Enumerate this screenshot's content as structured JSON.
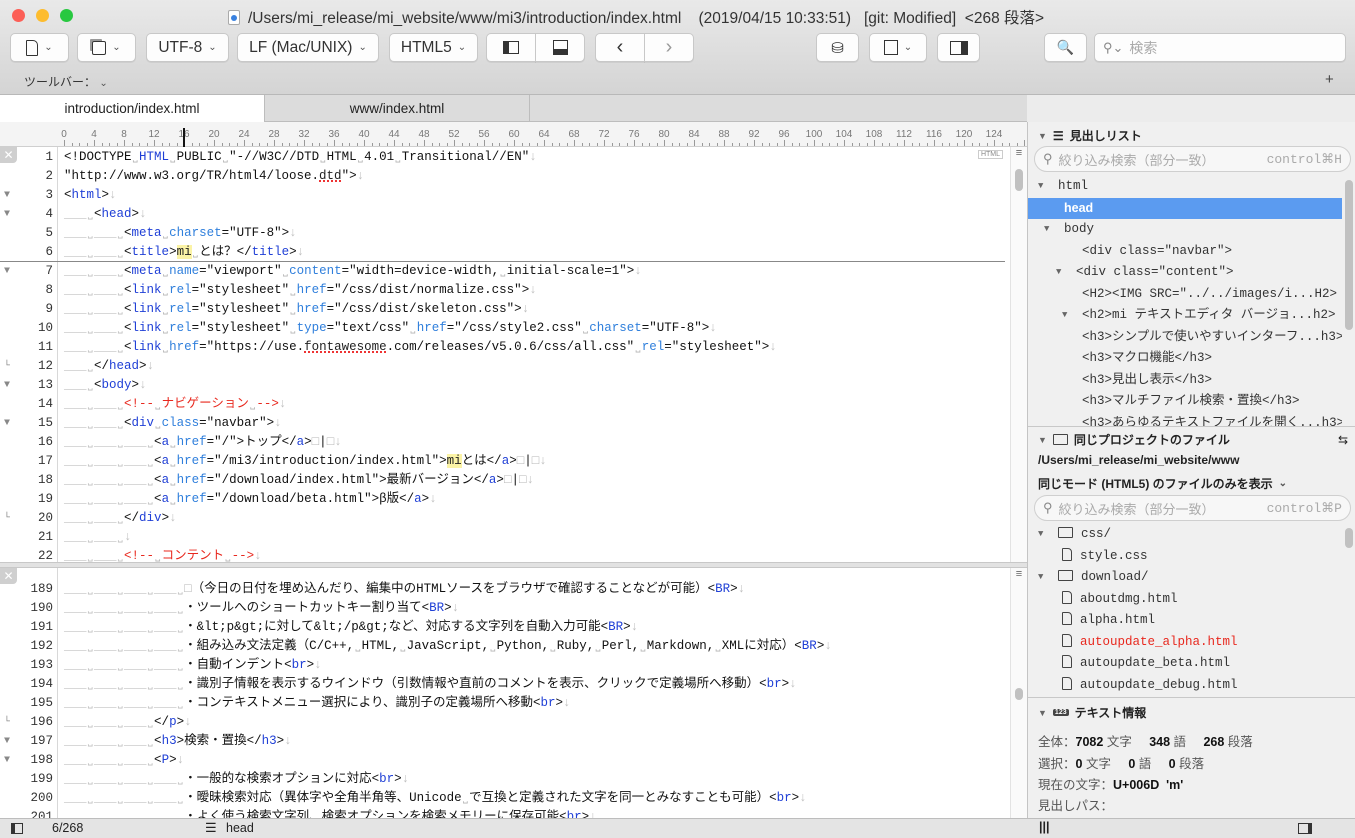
{
  "window": {
    "title": "/Users/mi_release/mi_website/www/mi3/introduction/index.html    (2019/04/15 10:33:51)   [git: Modified]  <268 段落>"
  },
  "toolbar": {
    "encoding": "UTF-8",
    "line_ending": "LF (Mac/UNIX)",
    "mode": "HTML5",
    "search_placeholder": "検索",
    "toolbar_label": "ツールバー：",
    "add_label": "+"
  },
  "tabs": [
    {
      "label": "introduction/index.html",
      "active": true
    },
    {
      "label": "www/index.html",
      "active": false
    }
  ],
  "ruler": {
    "labels": [
      "0",
      "4",
      "8",
      "12",
      "16",
      "20",
      "24",
      "28",
      "32",
      "36",
      "40",
      "44",
      "48",
      "52",
      "56",
      "60",
      "64",
      "68",
      "72",
      "76",
      "80",
      "84",
      "88",
      "92",
      "96",
      "100",
      "104",
      "108",
      "112",
      "116",
      "120",
      "124"
    ],
    "cursor_column": 16
  },
  "editor": {
    "mode_badge": "HTML",
    "top_pane": [
      {
        "n": "1",
        "i": 0,
        "t": [
          [
            "p",
            "<!DOCTYPE"
          ],
          [
            "s",
            "˽"
          ],
          [
            "k",
            "HTML"
          ],
          [
            "s",
            "˽"
          ],
          [
            "p",
            "PUBLIC"
          ],
          [
            "s",
            "˽"
          ],
          [
            "p",
            "\"-//W3C//DTD"
          ],
          [
            "s",
            "˽"
          ],
          [
            "p",
            "HTML"
          ],
          [
            "s",
            "˽"
          ],
          [
            "p",
            "4.01"
          ],
          [
            "s",
            "˽"
          ],
          [
            "p",
            "Transitional//EN\""
          ]
        ]
      },
      {
        "n": "2",
        "i": 0,
        "t": [
          [
            "p",
            "\"http://www.w3.org/TR/html4/loose."
          ],
          [
            "u",
            "dtd"
          ],
          [
            "p",
            "\">"
          ]
        ]
      },
      {
        "n": "3",
        "i": 0,
        "f": "▼",
        "t": [
          [
            "p",
            "<"
          ],
          [
            "k",
            "html"
          ],
          [
            "p",
            ">"
          ]
        ]
      },
      {
        "n": "4",
        "i": 1,
        "f": "▼",
        "t": [
          [
            "p",
            "<"
          ],
          [
            "k",
            "head"
          ],
          [
            "p",
            ">"
          ]
        ]
      },
      {
        "n": "5",
        "i": 2,
        "t": [
          [
            "p",
            "<"
          ],
          [
            "k",
            "meta"
          ],
          [
            "s",
            "˽"
          ],
          [
            "a",
            "charset"
          ],
          [
            "p",
            "=\"UTF-8\">"
          ]
        ]
      },
      {
        "n": "6",
        "i": 2,
        "t": [
          [
            "p",
            "<"
          ],
          [
            "k",
            "title"
          ],
          [
            "p",
            ">"
          ],
          [
            "h",
            "mi"
          ],
          [
            "s",
            "˽"
          ],
          [
            "p",
            "とは？</"
          ],
          [
            "k",
            "title"
          ],
          [
            "p",
            ">"
          ]
        ]
      },
      {
        "n": "7",
        "i": 2,
        "f": "▼",
        "t": [
          [
            "p",
            "<"
          ],
          [
            "k",
            "meta"
          ],
          [
            "s",
            "˽"
          ],
          [
            "a",
            "name"
          ],
          [
            "p",
            "=\"viewport\""
          ],
          [
            "s",
            "˽"
          ],
          [
            "a",
            "content"
          ],
          [
            "p",
            "=\"width=device-width,"
          ],
          [
            "s",
            "˽"
          ],
          [
            "p",
            "initial-scale=1\">"
          ]
        ]
      },
      {
        "n": "8",
        "i": 2,
        "t": [
          [
            "p",
            "<"
          ],
          [
            "k",
            "link"
          ],
          [
            "s",
            "˽"
          ],
          [
            "a",
            "rel"
          ],
          [
            "p",
            "=\"stylesheet\""
          ],
          [
            "s",
            "˽"
          ],
          [
            "a",
            "href"
          ],
          [
            "p",
            "=\"/css/dist/normalize.css\">"
          ]
        ]
      },
      {
        "n": "9",
        "i": 2,
        "t": [
          [
            "p",
            "<"
          ],
          [
            "k",
            "link"
          ],
          [
            "s",
            "˽"
          ],
          [
            "a",
            "rel"
          ],
          [
            "p",
            "=\"stylesheet\""
          ],
          [
            "s",
            "˽"
          ],
          [
            "a",
            "href"
          ],
          [
            "p",
            "=\"/css/dist/skeleton.css\">"
          ]
        ]
      },
      {
        "n": "10",
        "i": 2,
        "t": [
          [
            "p",
            "<"
          ],
          [
            "k",
            "link"
          ],
          [
            "s",
            "˽"
          ],
          [
            "a",
            "rel"
          ],
          [
            "p",
            "=\"stylesheet\""
          ],
          [
            "s",
            "˽"
          ],
          [
            "a",
            "type"
          ],
          [
            "p",
            "=\"text/css\""
          ],
          [
            "s",
            "˽"
          ],
          [
            "a",
            "href"
          ],
          [
            "p",
            "=\"/css/style2.css\""
          ],
          [
            "s",
            "˽"
          ],
          [
            "a",
            "charset"
          ],
          [
            "p",
            "=\"UTF-8\">"
          ]
        ]
      },
      {
        "n": "11",
        "i": 2,
        "t": [
          [
            "p",
            "<"
          ],
          [
            "k",
            "link"
          ],
          [
            "s",
            "˽"
          ],
          [
            "a",
            "href"
          ],
          [
            "p",
            "=\"https://use."
          ],
          [
            "u",
            "fontawesome"
          ],
          [
            "p",
            ".com/releases/v5.0.6/css/all.css\""
          ],
          [
            "s",
            "˽"
          ],
          [
            "a",
            "rel"
          ],
          [
            "p",
            "=\"stylesheet\">"
          ]
        ]
      },
      {
        "n": "12",
        "i": 1,
        "f": "└",
        "t": [
          [
            "p",
            "</"
          ],
          [
            "k",
            "head"
          ],
          [
            "p",
            ">"
          ]
        ]
      },
      {
        "n": "13",
        "i": 1,
        "f": "▼",
        "t": [
          [
            "p",
            "<"
          ],
          [
            "k",
            "body"
          ],
          [
            "p",
            ">"
          ]
        ]
      },
      {
        "n": "14",
        "i": 2,
        "t": [
          [
            "c",
            "<!--"
          ],
          [
            "s",
            "˽"
          ],
          [
            "c",
            "ナビゲーション"
          ],
          [
            "s",
            "˽"
          ],
          [
            "c",
            "-->"
          ]
        ]
      },
      {
        "n": "15",
        "i": 2,
        "f": "▼",
        "t": [
          [
            "p",
            "<"
          ],
          [
            "k",
            "div"
          ],
          [
            "s",
            "˽"
          ],
          [
            "a",
            "class"
          ],
          [
            "p",
            "=\"navbar\">"
          ]
        ]
      },
      {
        "n": "16",
        "i": 3,
        "t": [
          [
            "p",
            "<"
          ],
          [
            "k",
            "a"
          ],
          [
            "s",
            "˽"
          ],
          [
            "a",
            "href"
          ],
          [
            "p",
            "=\"/\">トップ</"
          ],
          [
            "k",
            "a"
          ],
          [
            "p",
            ">"
          ],
          [
            "g",
            "□"
          ],
          [
            "p",
            "|"
          ],
          [
            "g",
            "□"
          ]
        ]
      },
      {
        "n": "17",
        "i": 3,
        "t": [
          [
            "p",
            "<"
          ],
          [
            "k",
            "a"
          ],
          [
            "s",
            "˽"
          ],
          [
            "a",
            "href"
          ],
          [
            "p",
            "=\"/mi3/introduction/index.html\">"
          ],
          [
            "h",
            "mi"
          ],
          [
            "p",
            "とは</"
          ],
          [
            "k",
            "a"
          ],
          [
            "p",
            ">"
          ],
          [
            "g",
            "□"
          ],
          [
            "p",
            "|"
          ],
          [
            "g",
            "□"
          ]
        ]
      },
      {
        "n": "18",
        "i": 3,
        "t": [
          [
            "p",
            "<"
          ],
          [
            "k",
            "a"
          ],
          [
            "s",
            "˽"
          ],
          [
            "a",
            "href"
          ],
          [
            "p",
            "=\"/download/index.html\">最新バージョン</"
          ],
          [
            "k",
            "a"
          ],
          [
            "p",
            ">"
          ],
          [
            "g",
            "□"
          ],
          [
            "p",
            "|"
          ],
          [
            "g",
            "□"
          ]
        ]
      },
      {
        "n": "19",
        "i": 3,
        "t": [
          [
            "p",
            "<"
          ],
          [
            "k",
            "a"
          ],
          [
            "s",
            "˽"
          ],
          [
            "a",
            "href"
          ],
          [
            "p",
            "=\"/download/beta.html\">β版</"
          ],
          [
            "k",
            "a"
          ],
          [
            "p",
            ">"
          ]
        ]
      },
      {
        "n": "20",
        "i": 2,
        "f": "└",
        "t": [
          [
            "p",
            "</"
          ],
          [
            "k",
            "div"
          ],
          [
            "p",
            ">"
          ]
        ]
      },
      {
        "n": "21",
        "i": 2,
        "t": []
      },
      {
        "n": "22",
        "i": 2,
        "t": [
          [
            "c",
            "<!--"
          ],
          [
            "s",
            "˽"
          ],
          [
            "c",
            "コンテント"
          ],
          [
            "s",
            "˽"
          ],
          [
            "c",
            "-->"
          ]
        ]
      }
    ],
    "bottom_pane": [
      {
        "n": "189",
        "i": 4,
        "t": [
          [
            "g",
            "□"
          ],
          [
            "p",
            "（今日の日付を埋め込んだり、編集中のHTMLソースをブラウザで確認することなどが可能）<"
          ],
          [
            "k",
            "BR"
          ],
          [
            "p",
            ">"
          ]
        ]
      },
      {
        "n": "190",
        "i": 4,
        "t": [
          [
            "p",
            "・ツールへのショートカットキー割り当て<"
          ],
          [
            "k",
            "BR"
          ],
          [
            "p",
            ">"
          ]
        ]
      },
      {
        "n": "191",
        "i": 4,
        "t": [
          [
            "p",
            "・&lt;p&gt;に対して&lt;/p&gt;など、対応する文字列を自動入力可能<"
          ],
          [
            "k",
            "BR"
          ],
          [
            "p",
            ">"
          ]
        ]
      },
      {
        "n": "192",
        "i": 4,
        "t": [
          [
            "p",
            "・組み込み文法定義（C/C++,"
          ],
          [
            "s",
            "˽"
          ],
          [
            "p",
            "HTML,"
          ],
          [
            "s",
            "˽"
          ],
          [
            "p",
            "JavaScript,"
          ],
          [
            "s",
            "˽"
          ],
          [
            "p",
            "Python,"
          ],
          [
            "s",
            "˽"
          ],
          [
            "p",
            "Ruby,"
          ],
          [
            "s",
            "˽"
          ],
          [
            "p",
            "Perl,"
          ],
          [
            "s",
            "˽"
          ],
          [
            "p",
            "Markdown,"
          ],
          [
            "s",
            "˽"
          ],
          [
            "p",
            "XMLに対応）<"
          ],
          [
            "k",
            "BR"
          ],
          [
            "p",
            ">"
          ]
        ]
      },
      {
        "n": "193",
        "i": 4,
        "t": [
          [
            "p",
            "・自動インデント<"
          ],
          [
            "k",
            "br"
          ],
          [
            "p",
            ">"
          ]
        ]
      },
      {
        "n": "194",
        "i": 4,
        "t": [
          [
            "p",
            "・識別子情報を表示するウインドウ（引数情報や直前のコメントを表示、クリックで定義場所へ移動）<"
          ],
          [
            "k",
            "br"
          ],
          [
            "p",
            ">"
          ]
        ]
      },
      {
        "n": "195",
        "i": 4,
        "t": [
          [
            "p",
            "・コンテキストメニュー選択により、識別子の定義場所へ移動<"
          ],
          [
            "k",
            "br"
          ],
          [
            "p",
            ">"
          ]
        ]
      },
      {
        "n": "196",
        "i": 3,
        "f": "└",
        "t": [
          [
            "p",
            "</"
          ],
          [
            "k",
            "p"
          ],
          [
            "p",
            ">"
          ]
        ]
      },
      {
        "n": "197",
        "i": 3,
        "f": "▼",
        "t": [
          [
            "p",
            "<"
          ],
          [
            "k",
            "h3"
          ],
          [
            "p",
            ">検索・置換</"
          ],
          [
            "k",
            "h3"
          ],
          [
            "p",
            ">"
          ]
        ]
      },
      {
        "n": "198",
        "i": 3,
        "f": "▼",
        "t": [
          [
            "p",
            "<"
          ],
          [
            "k",
            "P"
          ],
          [
            "p",
            ">"
          ]
        ]
      },
      {
        "n": "199",
        "i": 4,
        "t": [
          [
            "p",
            "・一般的な検索オプションに対応<"
          ],
          [
            "k",
            "br"
          ],
          [
            "p",
            ">"
          ]
        ]
      },
      {
        "n": "200",
        "i": 4,
        "t": [
          [
            "p",
            "・曖昧検索対応（異体字や全角半角等、Unicode"
          ],
          [
            "s",
            "˽"
          ],
          [
            "p",
            "で互換と定義された文字を同一とみなすことも可能）<"
          ],
          [
            "k",
            "br"
          ],
          [
            "p",
            ">"
          ]
        ]
      },
      {
        "n": "201",
        "i": 4,
        "t": [
          [
            "p",
            "・よく使う検索文字列、検索オプションを検索メモリーに保存可能<"
          ],
          [
            "k",
            "br"
          ],
          [
            "p",
            ">"
          ]
        ]
      }
    ]
  },
  "sidebar": {
    "outline": {
      "title": "見出しリスト",
      "filter_placeholder": "絞り込み検索（部分一致）",
      "filter_shortcut": "control⌘H",
      "items": [
        {
          "label": "html",
          "depth": 0,
          "expanded": true
        },
        {
          "label": "head",
          "depth": 1,
          "selected": true
        },
        {
          "label": "body",
          "depth": 1,
          "expanded": true
        },
        {
          "label": "<div class=\"navbar\">",
          "depth": 2
        },
        {
          "label": "<div class=\"content\">",
          "depth": 2,
          "expanded": true
        },
        {
          "label": "<H2><IMG SRC=\"../../images/i...H2>",
          "depth": 3
        },
        {
          "label": "<h2>mi テキストエディタ バージョ...h2>",
          "depth": 3,
          "expanded": true
        },
        {
          "label": "<h3>シンプルで使いやすいインターフ...h3>",
          "depth": 3
        },
        {
          "label": "<h3>マクロ機能</h3>",
          "depth": 3
        },
        {
          "label": "<h3>見出し表示</h3>",
          "depth": 3
        },
        {
          "label": "<h3>マルチファイル検索・置換</h3>",
          "depth": 3
        },
        {
          "label": "<h3>あらゆるテキストファイルを開く...h3>",
          "depth": 3
        }
      ]
    },
    "project": {
      "title": "同じプロジェクトのファイル",
      "path": "/Users/mi_release/mi_website/www",
      "filter_mode": "同じモード (HTML5) のファイルのみを表示",
      "filter_placeholder": "絞り込み検索（部分一致）",
      "filter_shortcut": "control⌘P",
      "items": [
        {
          "label": "css/",
          "type": "folder",
          "depth": 0
        },
        {
          "label": "style.css",
          "type": "file",
          "depth": 1
        },
        {
          "label": "download/",
          "type": "folder",
          "depth": 0
        },
        {
          "label": "aboutdmg.html",
          "type": "file",
          "depth": 1
        },
        {
          "label": "alpha.html",
          "type": "file",
          "depth": 1
        },
        {
          "label": "autoupdate_alpha.html",
          "type": "file",
          "depth": 1,
          "color": "#e8281e"
        },
        {
          "label": "autoupdate_beta.html",
          "type": "file",
          "depth": 1
        },
        {
          "label": "autoupdate_debug.html",
          "type": "file",
          "depth": 1
        }
      ]
    },
    "textinfo": {
      "title": "テキスト情報",
      "total_label": "全体：",
      "total_chars": "7082",
      "total_words": "348",
      "total_paragraphs": "268",
      "selection_label": "選択：",
      "sel_chars": "0",
      "sel_words": "0",
      "sel_paragraphs": "0",
      "chars_unit": "文字",
      "words_unit": "語",
      "paragraphs_unit": "段落",
      "current_char_label": "現在の文字：",
      "current_char": "U+006D  'm'",
      "heading_path_label": "見出しパス："
    }
  },
  "statusbar": {
    "position": "6/268",
    "heading": "head",
    "columns_icon": "|||"
  },
  "colors": {
    "tag": "#1f3fd6",
    "attr": "#2f7fdc",
    "comment": "#e8281e",
    "selection": "#5b9bf0"
  }
}
